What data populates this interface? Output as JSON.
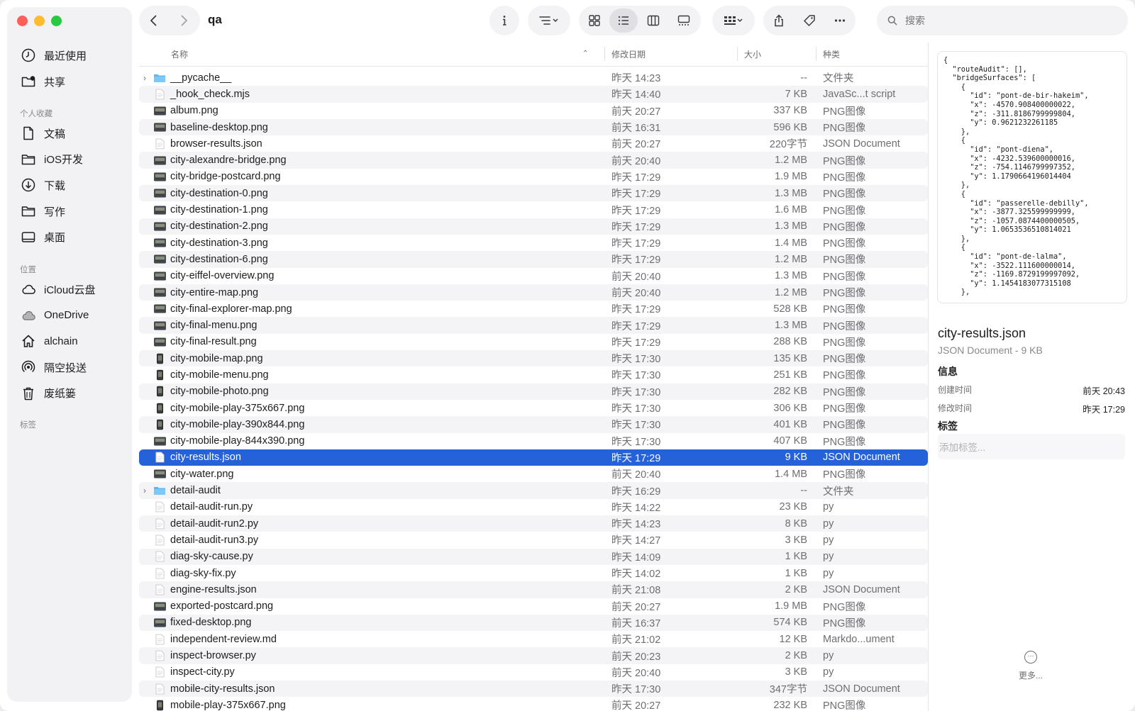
{
  "window": {
    "title": "qa"
  },
  "sidebar": {
    "items_top": [
      {
        "label": "最近使用",
        "icon": "clock-icon"
      },
      {
        "label": "共享",
        "icon": "shared-folder-icon"
      }
    ],
    "favorites_header": "个人收藏",
    "favorites": [
      {
        "label": "文稿",
        "icon": "document-icon"
      },
      {
        "label": "iOS开发",
        "icon": "folder-icon"
      },
      {
        "label": "下载",
        "icon": "download-icon"
      },
      {
        "label": "写作",
        "icon": "folder-icon"
      },
      {
        "label": "桌面",
        "icon": "desktop-icon"
      }
    ],
    "locations_header": "位置",
    "locations": [
      {
        "label": "iCloud云盘",
        "icon": "cloud-icon"
      },
      {
        "label": "OneDrive",
        "icon": "cloud-filled-icon"
      },
      {
        "label": "alchain",
        "icon": "home-icon"
      },
      {
        "label": "隔空投送",
        "icon": "airdrop-icon"
      },
      {
        "label": "废纸篓",
        "icon": "trash-icon"
      }
    ],
    "tags_header": "标签"
  },
  "search": {
    "placeholder": "搜索"
  },
  "columns": {
    "name": "名称",
    "date": "修改日期",
    "size": "大小",
    "kind": "种类"
  },
  "files": [
    {
      "name": "__pycache__",
      "date": "昨天 14:23",
      "size": "--",
      "kind": "文件夹",
      "type": "folder"
    },
    {
      "name": "_hook_check.mjs",
      "date": "昨天 14:40",
      "size": "7 KB",
      "kind": "JavaSc...t script",
      "type": "doc"
    },
    {
      "name": "album.png",
      "date": "前天 20:27",
      "size": "337 KB",
      "kind": "PNG图像",
      "type": "image"
    },
    {
      "name": "baseline-desktop.png",
      "date": "前天 16:31",
      "size": "596 KB",
      "kind": "PNG图像",
      "type": "image"
    },
    {
      "name": "browser-results.json",
      "date": "前天 20:27",
      "size": "220字节",
      "kind": "JSON Document",
      "type": "doc"
    },
    {
      "name": "city-alexandre-bridge.png",
      "date": "前天 20:40",
      "size": "1.2 MB",
      "kind": "PNG图像",
      "type": "image"
    },
    {
      "name": "city-bridge-postcard.png",
      "date": "昨天 17:29",
      "size": "1.9 MB",
      "kind": "PNG图像",
      "type": "image"
    },
    {
      "name": "city-destination-0.png",
      "date": "昨天 17:29",
      "size": "1.3 MB",
      "kind": "PNG图像",
      "type": "image"
    },
    {
      "name": "city-destination-1.png",
      "date": "昨天 17:29",
      "size": "1.6 MB",
      "kind": "PNG图像",
      "type": "image"
    },
    {
      "name": "city-destination-2.png",
      "date": "昨天 17:29",
      "size": "1.3 MB",
      "kind": "PNG图像",
      "type": "image"
    },
    {
      "name": "city-destination-3.png",
      "date": "昨天 17:29",
      "size": "1.4 MB",
      "kind": "PNG图像",
      "type": "image"
    },
    {
      "name": "city-destination-6.png",
      "date": "昨天 17:29",
      "size": "1.2 MB",
      "kind": "PNG图像",
      "type": "image"
    },
    {
      "name": "city-eiffel-overview.png",
      "date": "前天 20:40",
      "size": "1.3 MB",
      "kind": "PNG图像",
      "type": "image"
    },
    {
      "name": "city-entire-map.png",
      "date": "前天 20:40",
      "size": "1.2 MB",
      "kind": "PNG图像",
      "type": "image"
    },
    {
      "name": "city-final-explorer-map.png",
      "date": "昨天 17:29",
      "size": "528 KB",
      "kind": "PNG图像",
      "type": "image"
    },
    {
      "name": "city-final-menu.png",
      "date": "昨天 17:29",
      "size": "1.3 MB",
      "kind": "PNG图像",
      "type": "image"
    },
    {
      "name": "city-final-result.png",
      "date": "昨天 17:29",
      "size": "288 KB",
      "kind": "PNG图像",
      "type": "image"
    },
    {
      "name": "city-mobile-map.png",
      "date": "昨天 17:30",
      "size": "135 KB",
      "kind": "PNG图像",
      "type": "phone"
    },
    {
      "name": "city-mobile-menu.png",
      "date": "昨天 17:30",
      "size": "251 KB",
      "kind": "PNG图像",
      "type": "phone"
    },
    {
      "name": "city-mobile-photo.png",
      "date": "昨天 17:30",
      "size": "282 KB",
      "kind": "PNG图像",
      "type": "phone"
    },
    {
      "name": "city-mobile-play-375x667.png",
      "date": "昨天 17:30",
      "size": "306 KB",
      "kind": "PNG图像",
      "type": "phone"
    },
    {
      "name": "city-mobile-play-390x844.png",
      "date": "昨天 17:30",
      "size": "401 KB",
      "kind": "PNG图像",
      "type": "phone"
    },
    {
      "name": "city-mobile-play-844x390.png",
      "date": "昨天 17:30",
      "size": "407 KB",
      "kind": "PNG图像",
      "type": "image"
    },
    {
      "name": "city-results.json",
      "date": "昨天 17:29",
      "size": "9 KB",
      "kind": "JSON Document",
      "type": "doc",
      "selected": true
    },
    {
      "name": "city-water.png",
      "date": "前天 20:40",
      "size": "1.4 MB",
      "kind": "PNG图像",
      "type": "image"
    },
    {
      "name": "detail-audit",
      "date": "昨天 16:29",
      "size": "--",
      "kind": "文件夹",
      "type": "folder"
    },
    {
      "name": "detail-audit-run.py",
      "date": "昨天 14:22",
      "size": "23 KB",
      "kind": "py",
      "type": "doc"
    },
    {
      "name": "detail-audit-run2.py",
      "date": "昨天 14:23",
      "size": "8 KB",
      "kind": "py",
      "type": "doc"
    },
    {
      "name": "detail-audit-run3.py",
      "date": "昨天 14:27",
      "size": "3 KB",
      "kind": "py",
      "type": "doc"
    },
    {
      "name": "diag-sky-cause.py",
      "date": "昨天 14:09",
      "size": "1 KB",
      "kind": "py",
      "type": "doc"
    },
    {
      "name": "diag-sky-fix.py",
      "date": "昨天 14:02",
      "size": "1 KB",
      "kind": "py",
      "type": "doc"
    },
    {
      "name": "engine-results.json",
      "date": "前天 21:08",
      "size": "2 KB",
      "kind": "JSON Document",
      "type": "doc"
    },
    {
      "name": "exported-postcard.png",
      "date": "前天 20:27",
      "size": "1.9 MB",
      "kind": "PNG图像",
      "type": "image"
    },
    {
      "name": "fixed-desktop.png",
      "date": "前天 16:37",
      "size": "574 KB",
      "kind": "PNG图像",
      "type": "image"
    },
    {
      "name": "independent-review.md",
      "date": "前天 21:02",
      "size": "12 KB",
      "kind": "Markdo...ument",
      "type": "doc"
    },
    {
      "name": "inspect-browser.py",
      "date": "前天 20:23",
      "size": "2 KB",
      "kind": "py",
      "type": "doc"
    },
    {
      "name": "inspect-city.py",
      "date": "前天 20:40",
      "size": "3 KB",
      "kind": "py",
      "type": "doc"
    },
    {
      "name": "mobile-city-results.json",
      "date": "昨天 17:30",
      "size": "347字节",
      "kind": "JSON Document",
      "type": "doc"
    },
    {
      "name": "mobile-play-375x667.png",
      "date": "前天 20:27",
      "size": "232 KB",
      "kind": "PNG图像",
      "type": "phone"
    }
  ],
  "inspector": {
    "preview": "{\n  \"routeAudit\": [],\n  \"bridgeSurfaces\": [\n    {\n      \"id\": \"pont-de-bir-hakeim\",\n      \"x\": -4570.908400000022,\n      \"z\": -311.8186799999804,\n      \"y\": 0.9621232261185\n    },\n    {\n      \"id\": \"pont-diena\",\n      \"x\": -4232.539600000016,\n      \"z\": -754.1146799997352,\n      \"y\": 1.1790664196014404\n    },\n    {\n      \"id\": \"passerelle-debilly\",\n      \"x\": -3877.325599999999,\n      \"z\": -1057.0874400000505,\n      \"y\": 1.0653536510814021\n    },\n    {\n      \"id\": \"pont-de-lalma\",\n      \"x\": -3522.111600000014,\n      \"z\": -1169.8729199997092,\n      \"y\": 1.1454183077315108\n    },",
    "file_name": "city-results.json",
    "file_meta": "JSON Document - 9 KB",
    "info_header": "信息",
    "created_label": "创建时间",
    "created_value": "前天 20:43",
    "modified_label": "修改时间",
    "modified_value": "昨天 17:29",
    "tags_header": "标签",
    "tags_placeholder": "添加标签...",
    "more_label": "更多..."
  }
}
